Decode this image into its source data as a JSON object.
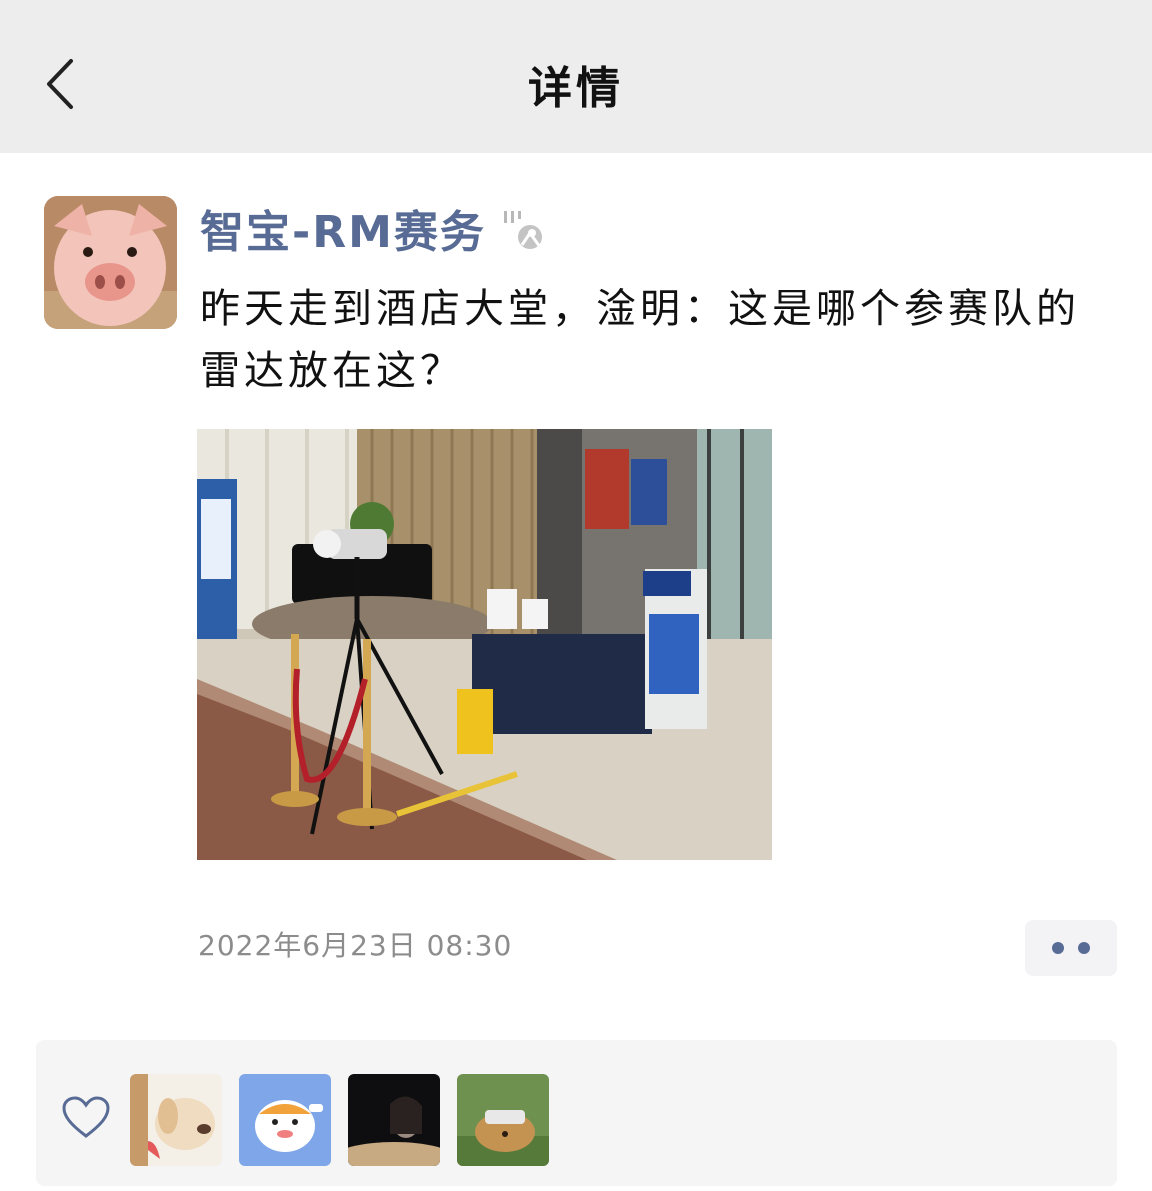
{
  "header": {
    "title": "详情",
    "back_icon": "chevron-left-icon"
  },
  "post": {
    "author_name": "智宝-RM赛务",
    "text": "昨天走到酒店大堂，淦明：这是哪个参赛队的雷达放在这？",
    "timestamp": "2022年6月23日  08:30"
  },
  "likes": {
    "icon": "heart-icon",
    "avatars": [
      "dog-avatar",
      "cartoon-tiger-avatar",
      "person-night-avatar",
      "dog-vr-avatar"
    ]
  },
  "colors": {
    "link": "#576b95",
    "header_bg": "#ededed"
  }
}
